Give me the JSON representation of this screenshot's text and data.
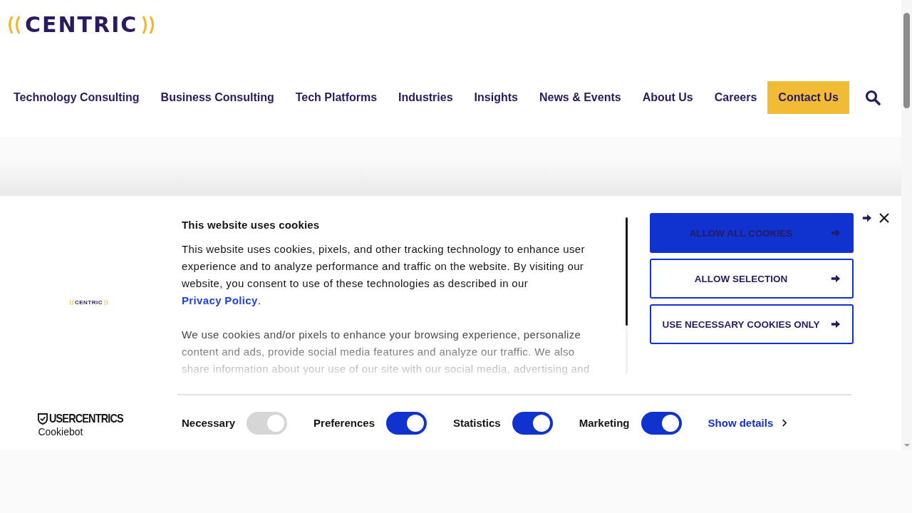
{
  "header": {
    "logo": "CENTRIC",
    "nav": [
      {
        "label": "Technology Consulting",
        "kind": "link"
      },
      {
        "label": "Business Consulting",
        "kind": "link"
      },
      {
        "label": "Tech Platforms",
        "kind": "link"
      },
      {
        "label": "Industries",
        "kind": "link"
      },
      {
        "label": "Insights",
        "kind": "link"
      },
      {
        "label": "News & Events",
        "kind": "link"
      },
      {
        "label": "About Us",
        "kind": "link"
      },
      {
        "label": "Careers",
        "kind": "link"
      },
      {
        "label": "Contact Us",
        "kind": "cta"
      }
    ]
  },
  "cookie_banner": {
    "brand_logo": "CENTRIC",
    "provider": {
      "name": "USERCENTRICS",
      "product": "Cookiebot"
    },
    "title": "This website uses cookies",
    "intro": "This website uses cookies, pixels, and other tracking technology to enhance user experience and to analyze performance and traffic on the website. By visiting our website, you consent to use of these technologies as described in our",
    "privacy_link": "Privacy Policy",
    "intro_end": ".",
    "details": "We use cookies and/or pixels to enhance your browsing experience, personalize content and ads, provide social media features and analyze our traffic. We also share information about your use of our site with our social media, advertising and",
    "buttons": [
      {
        "label": "ALLOW ALL COOKIES",
        "kind": "primary"
      },
      {
        "label": "ALLOW SELECTION",
        "kind": "outline"
      },
      {
        "label": "USE NECESSARY COOKIES ONLY",
        "kind": "outline"
      }
    ],
    "toggles": [
      {
        "label": "Necessary",
        "checked": true,
        "disabled": true
      },
      {
        "label": "Preferences",
        "checked": true,
        "disabled": false
      },
      {
        "label": "Statistics",
        "checked": true,
        "disabled": false
      },
      {
        "label": "Marketing",
        "checked": true,
        "disabled": false
      }
    ],
    "show_details": "Show details"
  }
}
